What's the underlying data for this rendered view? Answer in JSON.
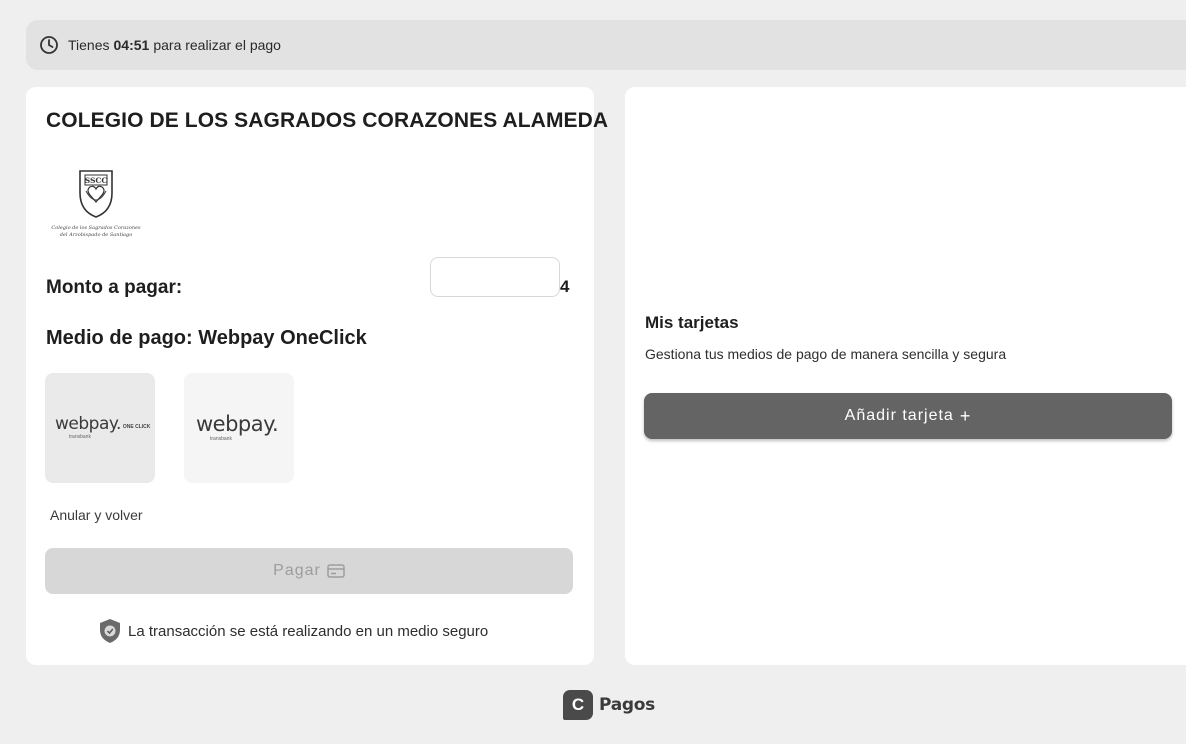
{
  "timer": {
    "prefix": "Tienes",
    "time": "04:51",
    "suffix": "para realizar el pago",
    "icon": "clock-icon"
  },
  "payment": {
    "merchant_name": "COLEGIO DE LOS SAGRADOS CORAZONES ALAMEDA",
    "logo": {
      "seal_text": "SSCC",
      "line1": "Colegio de los Sagrados Corazones",
      "line2": "del Arzobispado de Santiago"
    },
    "amount_label": "Monto a pagar:",
    "amount_value": "4",
    "method_label": "Medio de pago: Webpay OneClick",
    "methods": [
      {
        "name": "webpay.",
        "badge": "ONE CLICK",
        "sub": "transbank",
        "selected": true
      },
      {
        "name": "webpay.",
        "badge": "",
        "sub": "transbank",
        "selected": false
      }
    ],
    "cancel_link": "Anular y volver",
    "pay_button": "Pagar",
    "secure_note": "La transacción se está realizando en un medio seguro"
  },
  "cards": {
    "title": "Mis tarjetas",
    "subtitle": "Gestiona tus medios de pago de manera sencilla y segura",
    "add_button": "Añadir tarjeta",
    "add_button_icon": "+"
  },
  "footer": {
    "brand_letter": "C",
    "brand_name": "Pagos"
  },
  "colors": {
    "background": "#efefef",
    "card": "#ffffff",
    "primary_button": "#646464",
    "disabled_button": "#d7d7d7"
  }
}
